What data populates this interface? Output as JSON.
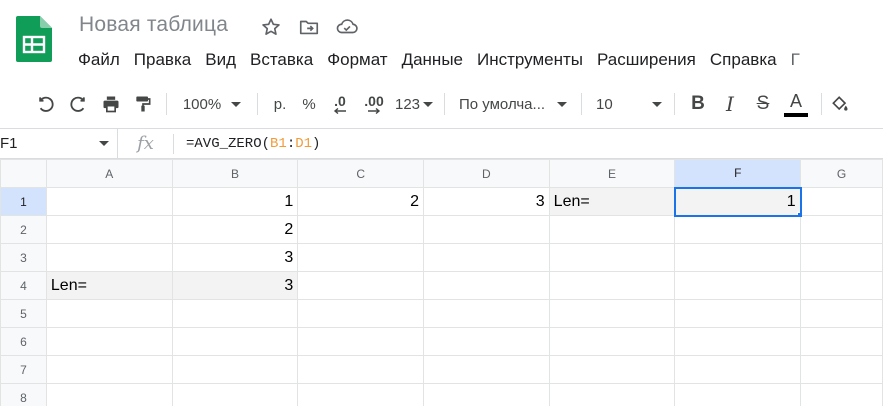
{
  "document": {
    "title": "Новая таблица"
  },
  "menu": [
    "Файл",
    "Правка",
    "Вид",
    "Вставка",
    "Формат",
    "Данные",
    "Инструменты",
    "Расширения",
    "Справка",
    "Г"
  ],
  "toolbar": {
    "zoom": "100%",
    "currency": "р.",
    "percent": "%",
    "decrease_decimals": ".0",
    "increase_decimals": ".00",
    "more_formats": "123",
    "font_family": "По умолча...",
    "font_size": "10",
    "bold": "B",
    "italic": "I",
    "strikethrough": "S",
    "text_color_letter": "A",
    "text_color": "#000000"
  },
  "formula_bar": {
    "cell_ref": "F1",
    "fx_label": "fx",
    "formula_prefix": "=AVG_ZERO(",
    "formula_ref_start": "B1",
    "formula_colon": ":",
    "formula_ref_end": "D1",
    "formula_suffix": ")"
  },
  "sheet": {
    "columns": [
      "A",
      "B",
      "C",
      "D",
      "E",
      "F",
      "G"
    ],
    "rows": [
      "1",
      "2",
      "3",
      "4",
      "5",
      "6",
      "7",
      "8"
    ],
    "selected_column": "F",
    "selected_row": "1",
    "cells": {
      "B1": "1",
      "C1": "2",
      "D1": "3",
      "E1": "Len=",
      "F1": "1",
      "B2": "2",
      "B3": "3",
      "A4": "Len=",
      "B4": "3"
    }
  },
  "colors": {
    "accent": "#1a73e8",
    "logo_green": "#0f9d58",
    "formula_ref": "#f29b3a"
  }
}
